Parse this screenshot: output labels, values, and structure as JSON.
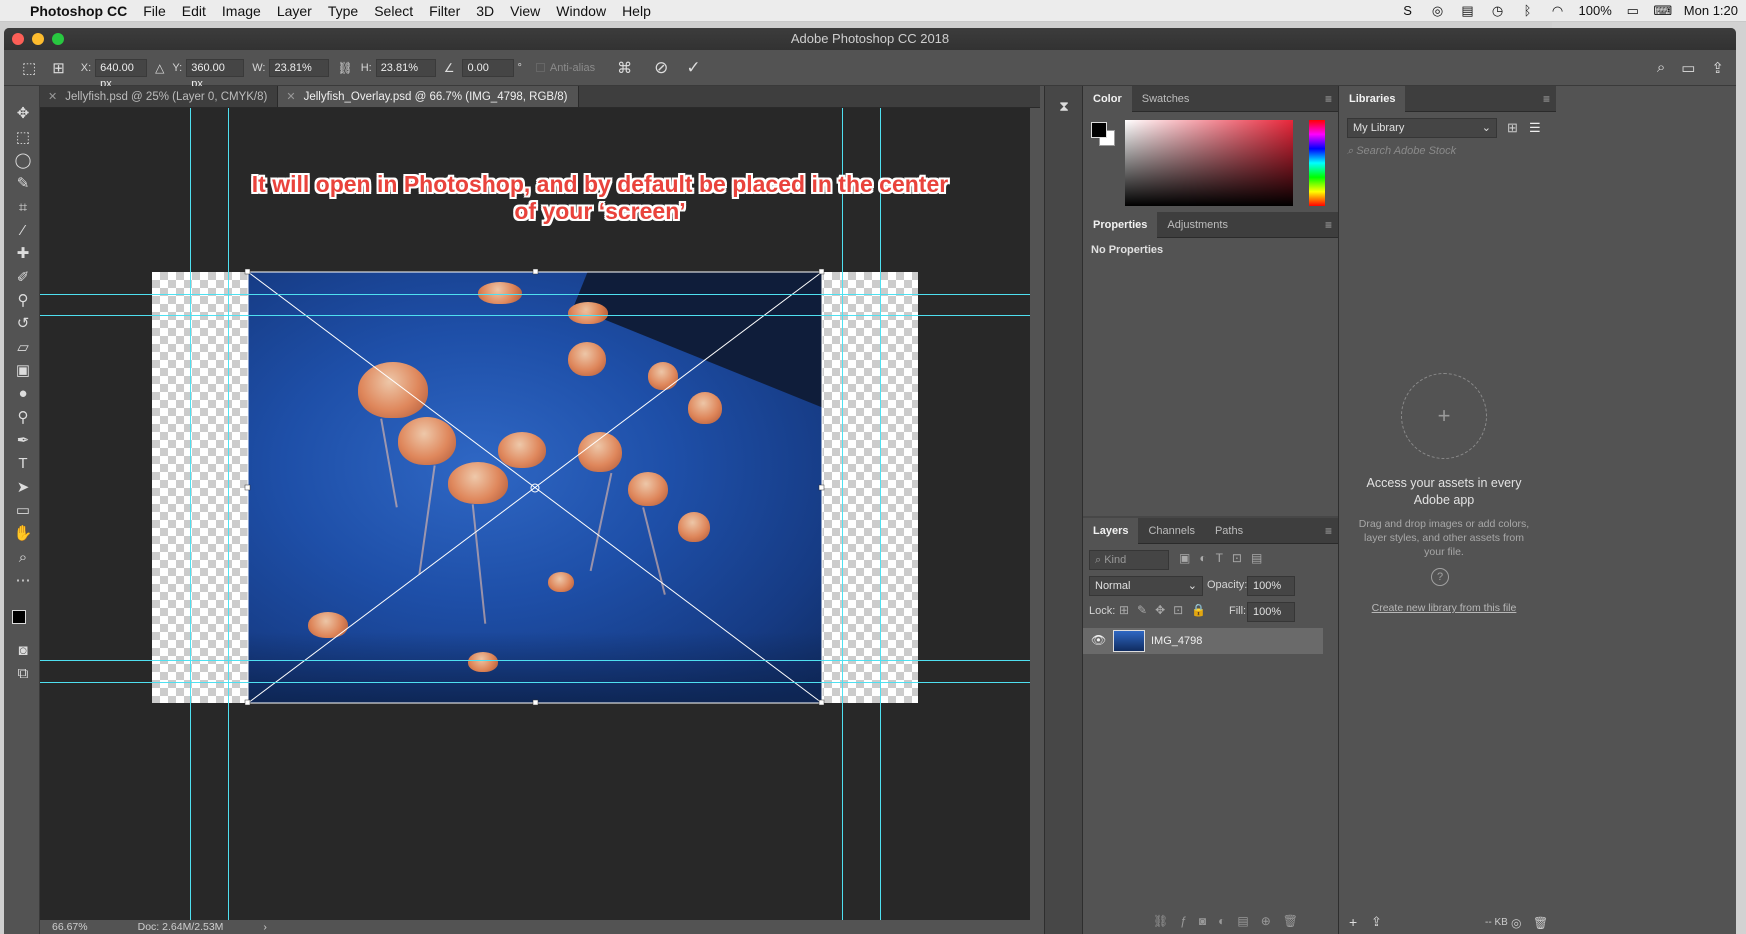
{
  "menubar": {
    "app": "Photoshop CC",
    "items": [
      "File",
      "Edit",
      "Image",
      "Layer",
      "Type",
      "Select",
      "Filter",
      "3D",
      "View",
      "Window",
      "Help"
    ],
    "battery": "100%",
    "clock": "Mon 1:20"
  },
  "window": {
    "title": "Adobe Photoshop CC 2018"
  },
  "options": {
    "x_label": "X:",
    "x_value": "640.00 px",
    "y_label": "Y:",
    "y_value": "360.00 px",
    "w_label": "W:",
    "w_value": "23.81%",
    "h_label": "H:",
    "h_value": "23.81%",
    "angle_value": "0.00",
    "degree": "°",
    "antialias": "Anti-alias"
  },
  "tabs": [
    {
      "label": "Jellyfish.psd @ 25% (Layer 0, CMYK/8)"
    },
    {
      "label": "Jellyfish_Overlay.psd @ 66.7% (IMG_4798, RGB/8)"
    }
  ],
  "annotation": {
    "line1": "It will open in Photoshop, and by default be placed in the center",
    "line2": "of your ‘screen’"
  },
  "status": {
    "zoom": "66.67%",
    "doc": "Doc: 2.64M/2.53M"
  },
  "color_panel": {
    "tab_color": "Color",
    "tab_swatches": "Swatches"
  },
  "properties_panel": {
    "tab_properties": "Properties",
    "tab_adjustments": "Adjustments",
    "content": "No Properties"
  },
  "layers_panel": {
    "tab_layers": "Layers",
    "tab_channels": "Channels",
    "tab_paths": "Paths",
    "kind_placeholder": "Kind",
    "blend_mode": "Normal",
    "opacity_label": "Opacity:",
    "opacity_value": "100%",
    "lock_label": "Lock:",
    "fill_label": "Fill:",
    "fill_value": "100%",
    "layers": [
      {
        "name": "IMG_4798",
        "visible": true
      }
    ]
  },
  "libraries_panel": {
    "title": "Libraries",
    "library": "My Library",
    "search_placeholder": "Search Adobe Stock",
    "heading": "Access your assets in every Adobe app",
    "body": "Drag and drop images or add colors, layer styles, and other assets from your file.",
    "link": "Create new library from this file",
    "size": "-- KB"
  },
  "colors": {
    "guide": "#4fe0f0",
    "annotation": "#e9433c",
    "panel_bg": "#535353"
  }
}
